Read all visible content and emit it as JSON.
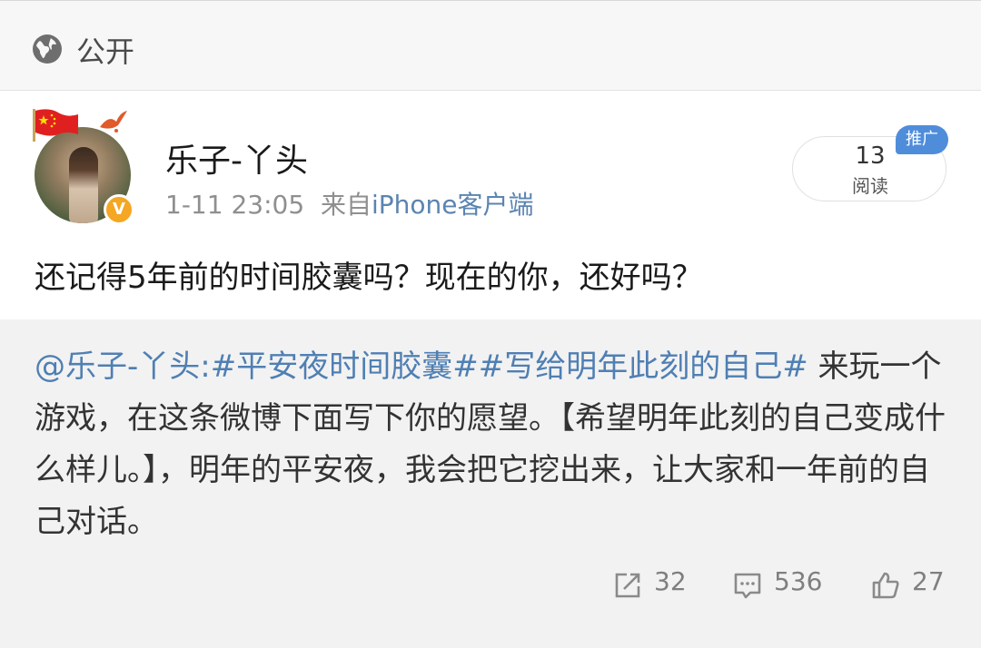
{
  "visibility": {
    "label": "公开",
    "icon": "globe-icon"
  },
  "post": {
    "author": "乐子-丫头",
    "timestamp": "1-11 23:05",
    "source_prefix": "来自",
    "source": "iPhone客户端",
    "read_count": "13",
    "read_label": "阅读",
    "promo_badge": "推广",
    "content": "还记得5年前的时间胶囊吗？现在的你，还好吗？"
  },
  "repost": {
    "mention": "@乐子-丫头:",
    "topic1": "#平安夜时间胶囊#",
    "topic2": "#写给明年此刻的自己#",
    "body": " 来玩一个游戏，在这条微博下面写下你的愿望。【希望明年此刻的自己变成什么样儿。】，明年的平安夜，我会把它挖出来，让大家和一年前的自己对话。"
  },
  "actions": {
    "repost_count": "32",
    "comment_count": "536",
    "like_count": "27"
  },
  "colors": {
    "link": "#4f7fb3",
    "promo": "#4f8ddb",
    "verified": "#f5a623"
  }
}
